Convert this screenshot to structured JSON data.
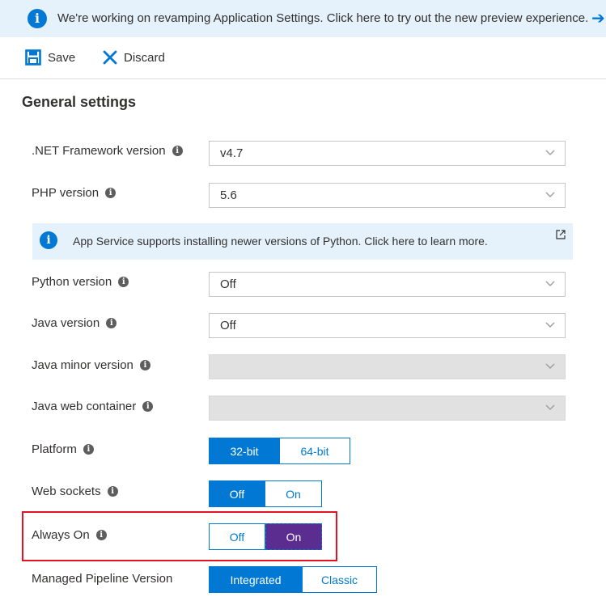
{
  "banner": {
    "text": "We're working on revamping Application Settings. Click here to try out the new preview experience.",
    "info_glyph": "i",
    "arrow_glyph": "➔"
  },
  "toolbar": {
    "save_label": "Save",
    "discard_label": "Discard"
  },
  "section_title": "General settings",
  "info_glyph": "i",
  "settings": {
    "net_framework": {
      "label": ".NET Framework version",
      "value": "v4.7"
    },
    "php": {
      "label": "PHP version",
      "value": "5.6"
    },
    "python_banner": {
      "text": "App Service supports installing newer versions of Python. Click here to learn more."
    },
    "python": {
      "label": "Python version",
      "value": "Off"
    },
    "java": {
      "label": "Java version",
      "value": "Off"
    },
    "java_minor": {
      "label": "Java minor version",
      "value": ""
    },
    "java_container": {
      "label": "Java web container",
      "value": ""
    },
    "platform": {
      "label": "Platform",
      "options": [
        "32-bit",
        "64-bit"
      ],
      "selected": "32-bit"
    },
    "web_sockets": {
      "label": "Web sockets",
      "options": [
        "Off",
        "On"
      ],
      "selected": "Off"
    },
    "always_on": {
      "label": "Always On",
      "options": [
        "Off",
        "On"
      ],
      "selected": "On"
    },
    "pipeline": {
      "label": "Managed Pipeline Version",
      "options": [
        "Integrated",
        "Classic"
      ],
      "selected": "Integrated"
    }
  },
  "colors": {
    "accent": "#0078d4",
    "banner_bg": "#e5f1fb",
    "highlight": "#e81123",
    "selected_purple": "#5c2d91"
  }
}
